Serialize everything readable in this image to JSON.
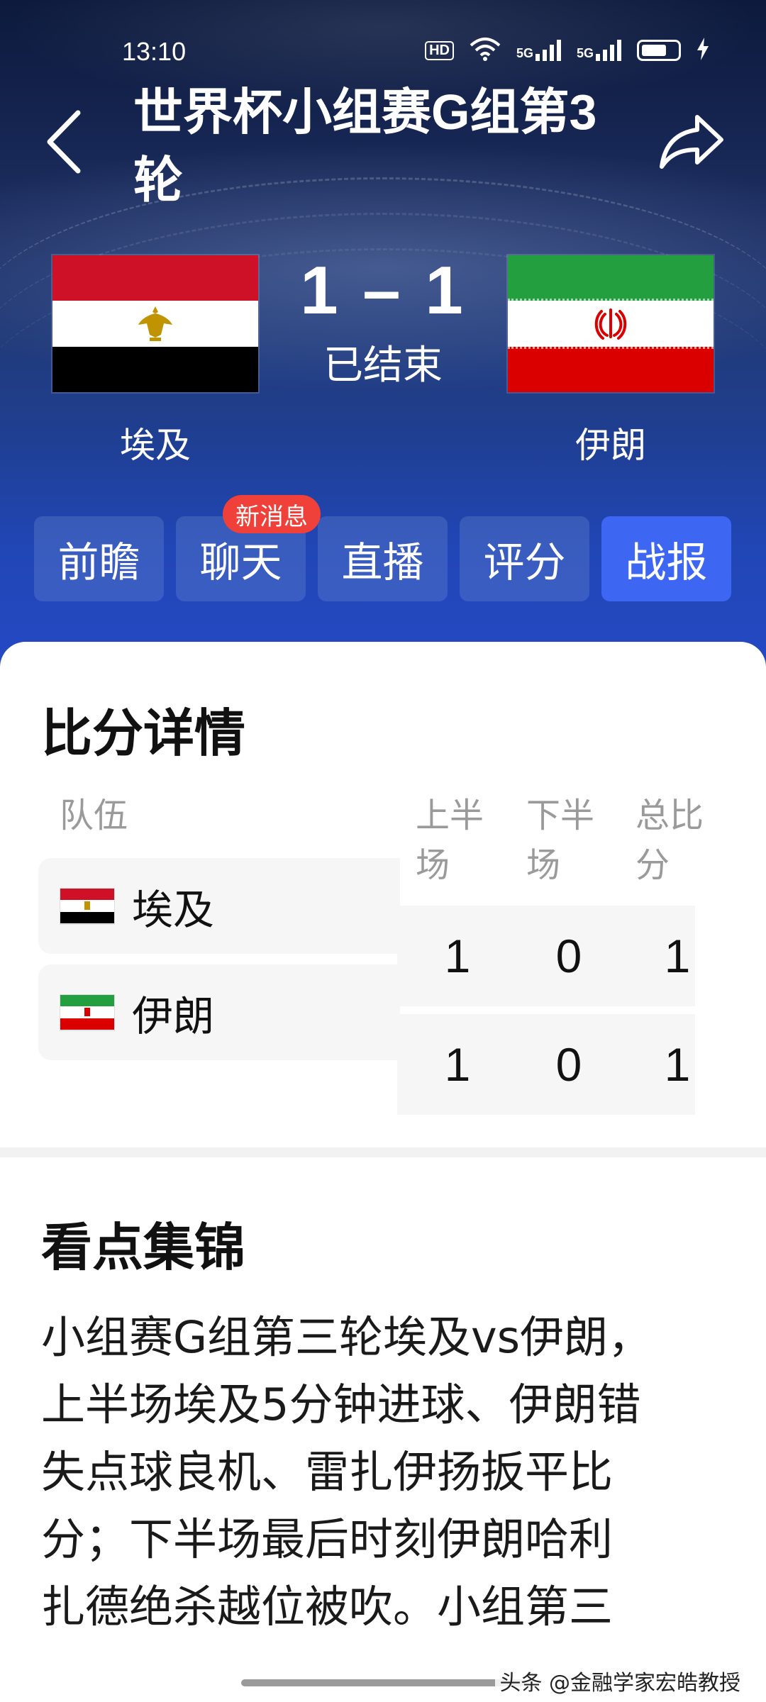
{
  "status_bar": {
    "time": "13:10",
    "icons": [
      "hd-icon",
      "wifi-icon",
      "signal-5g-icon",
      "signal-5g-icon",
      "battery-icon",
      "charging-icon"
    ],
    "hd_label": "HD",
    "net1": "5G",
    "net2": "5G"
  },
  "header": {
    "title": "世界杯小组赛G组第3轮",
    "back_icon": "chevron-left-icon",
    "share_icon": "share-arrow-icon"
  },
  "match": {
    "home": {
      "name": "埃及",
      "flag_colors": [
        "#ce1126",
        "#ffffff",
        "#000000"
      ],
      "emblem_color": "#c09300"
    },
    "away": {
      "name": "伊朗",
      "flag_colors": [
        "#239f40",
        "#ffffff",
        "#da0000"
      ],
      "emblem_color": "#da0000"
    },
    "score": "1 – 1",
    "status": "已结束"
  },
  "tabs": {
    "items": [
      {
        "label": "前瞻",
        "active": false
      },
      {
        "label": "聊天",
        "active": false
      },
      {
        "label": "直播",
        "active": false
      },
      {
        "label": "评分",
        "active": false
      },
      {
        "label": "战报",
        "active": true
      }
    ],
    "badge": "新消息"
  },
  "score_details": {
    "title": "比分详情",
    "columns": {
      "team": "队伍",
      "first_half": [
        "上半",
        "场"
      ],
      "second_half": [
        "下半",
        "场"
      ],
      "total": [
        "总比",
        "分"
      ]
    },
    "rows": [
      {
        "team": "埃及",
        "first_half": "1",
        "second_half": "0",
        "total": "1"
      },
      {
        "team": "伊朗",
        "first_half": "1",
        "second_half": "0",
        "total": "1"
      }
    ]
  },
  "highlights": {
    "title": "看点集锦",
    "lines": [
      "小组赛G组第三轮埃及vs伊朗，",
      "上半场埃及5分钟进球、伊朗错",
      "失点球良机、雷扎伊扬扳平比",
      "分；下半场最后时刻伊朗哈利",
      "扎德绝杀越位被吹。小组第三"
    ]
  },
  "watermark": "头条 @金融学家宏皓教授",
  "accent": "#3d67f3",
  "badge_color": "#f0403a"
}
